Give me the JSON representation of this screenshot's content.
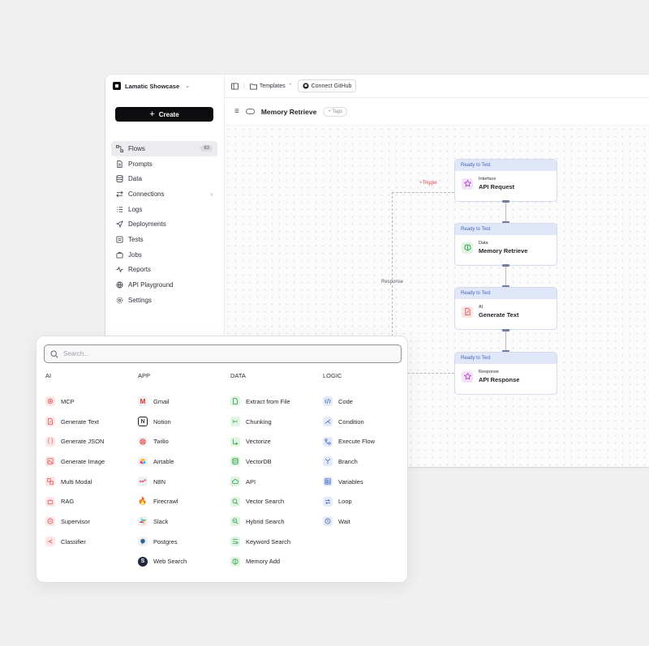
{
  "workspace": {
    "name": "Lamatic Showcase"
  },
  "sidebar": {
    "create_label": "Create",
    "items": [
      {
        "label": "Flows",
        "badge": "63",
        "icon": "flows-icon",
        "active": true
      },
      {
        "label": "Prompts",
        "icon": "document-icon"
      },
      {
        "label": "Data",
        "icon": "database-icon"
      },
      {
        "label": "Connections",
        "icon": "connections-icon",
        "chevron": true
      },
      {
        "label": "Logs",
        "icon": "list-icon"
      },
      {
        "label": "Deployments",
        "icon": "send-icon"
      },
      {
        "label": "Tests",
        "icon": "tests-icon"
      },
      {
        "label": "Jobs",
        "icon": "briefcase-icon"
      },
      {
        "label": "Reports",
        "icon": "activity-icon"
      },
      {
        "label": "API Playground",
        "icon": "globe-icon"
      },
      {
        "label": "Settings",
        "icon": "gear-icon"
      }
    ]
  },
  "topbar": {
    "templates_label": "Templates",
    "github_label": "Connect GitHub"
  },
  "flow": {
    "name": "Memory Retrieve",
    "tags_label": "+ Tags"
  },
  "canvas": {
    "trigger_label": "+Trigger",
    "response_label": "Response",
    "nodes": [
      {
        "status": "Ready to Test",
        "category": "Interface",
        "name": "API Request",
        "icon": "interface-icon"
      },
      {
        "status": "Ready to Test",
        "category": "Data",
        "name": "Memory Retrieve",
        "icon": "brain-icon"
      },
      {
        "status": "Ready to Test",
        "category": "AI",
        "name": "Generate Text",
        "icon": "generate-text-icon"
      },
      {
        "status": "Ready to Test",
        "category": "Response",
        "name": "API Response",
        "icon": "interface-icon"
      }
    ]
  },
  "palette": {
    "search_placeholder": "Search...",
    "columns": [
      {
        "title": "AI",
        "items": [
          "MCP",
          "Generate Text",
          "Generate JSON",
          "Generate Image",
          "Multi Modal",
          "RAG",
          "Supervisor",
          "Classifier"
        ]
      },
      {
        "title": "APP",
        "items": [
          "Gmail",
          "Notion",
          "Twilio",
          "Airtable",
          "N8N",
          "Firecrawl",
          "Slack",
          "Postgres",
          "Web Search"
        ]
      },
      {
        "title": "DATA",
        "items": [
          "Extract from File",
          "Chunking",
          "Vectorize",
          "VectorDB",
          "API",
          "Vector Search",
          "Hybrid Search",
          "Keyword Search",
          "Memory Add"
        ]
      },
      {
        "title": "LOGIC",
        "items": [
          "Code",
          "Condition",
          "Execute Flow",
          "Branch",
          "Variables",
          "Loop",
          "Wait"
        ]
      }
    ]
  },
  "colors": {
    "ai": "#e05757",
    "data": "#2fa046",
    "logic": "#4a6fbf",
    "status": "#4567b7",
    "trigger": "#e5484d"
  }
}
